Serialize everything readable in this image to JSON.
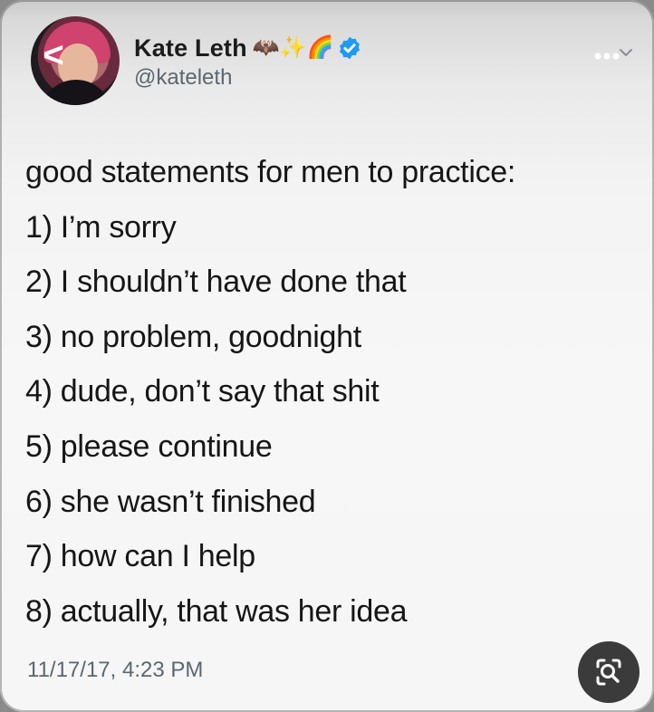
{
  "tweet": {
    "author": {
      "display_name": "Kate Leth",
      "handle": "@kateleth",
      "name_emoji": "🦇✨🌈",
      "verified_icon": "verified-badge-icon",
      "avatar_icon": "profile-avatar"
    },
    "lines": [
      "good statements for men to practice:",
      "1) I’m sorry",
      "2) I shouldn’t have done that",
      "3) no problem, goodnight",
      "4) dude, don’t say that shit",
      "5) please continue",
      "6) she wasn’t finished",
      "7) how can I help",
      "8) actually, that was her idea"
    ],
    "timestamp": "11/17/17, 4:23 PM"
  },
  "controls": {
    "back_icon": "back-chevron-icon",
    "back_glyph": "<",
    "more_icon": "more-options-icon",
    "lens_icon": "image-search-icon"
  },
  "colors": {
    "text": "#161616",
    "secondary_text": "#5b6770",
    "verified_blue": "#1d9bf0",
    "background": "#f6f6f6",
    "lens_button": "#3b3b3b"
  }
}
